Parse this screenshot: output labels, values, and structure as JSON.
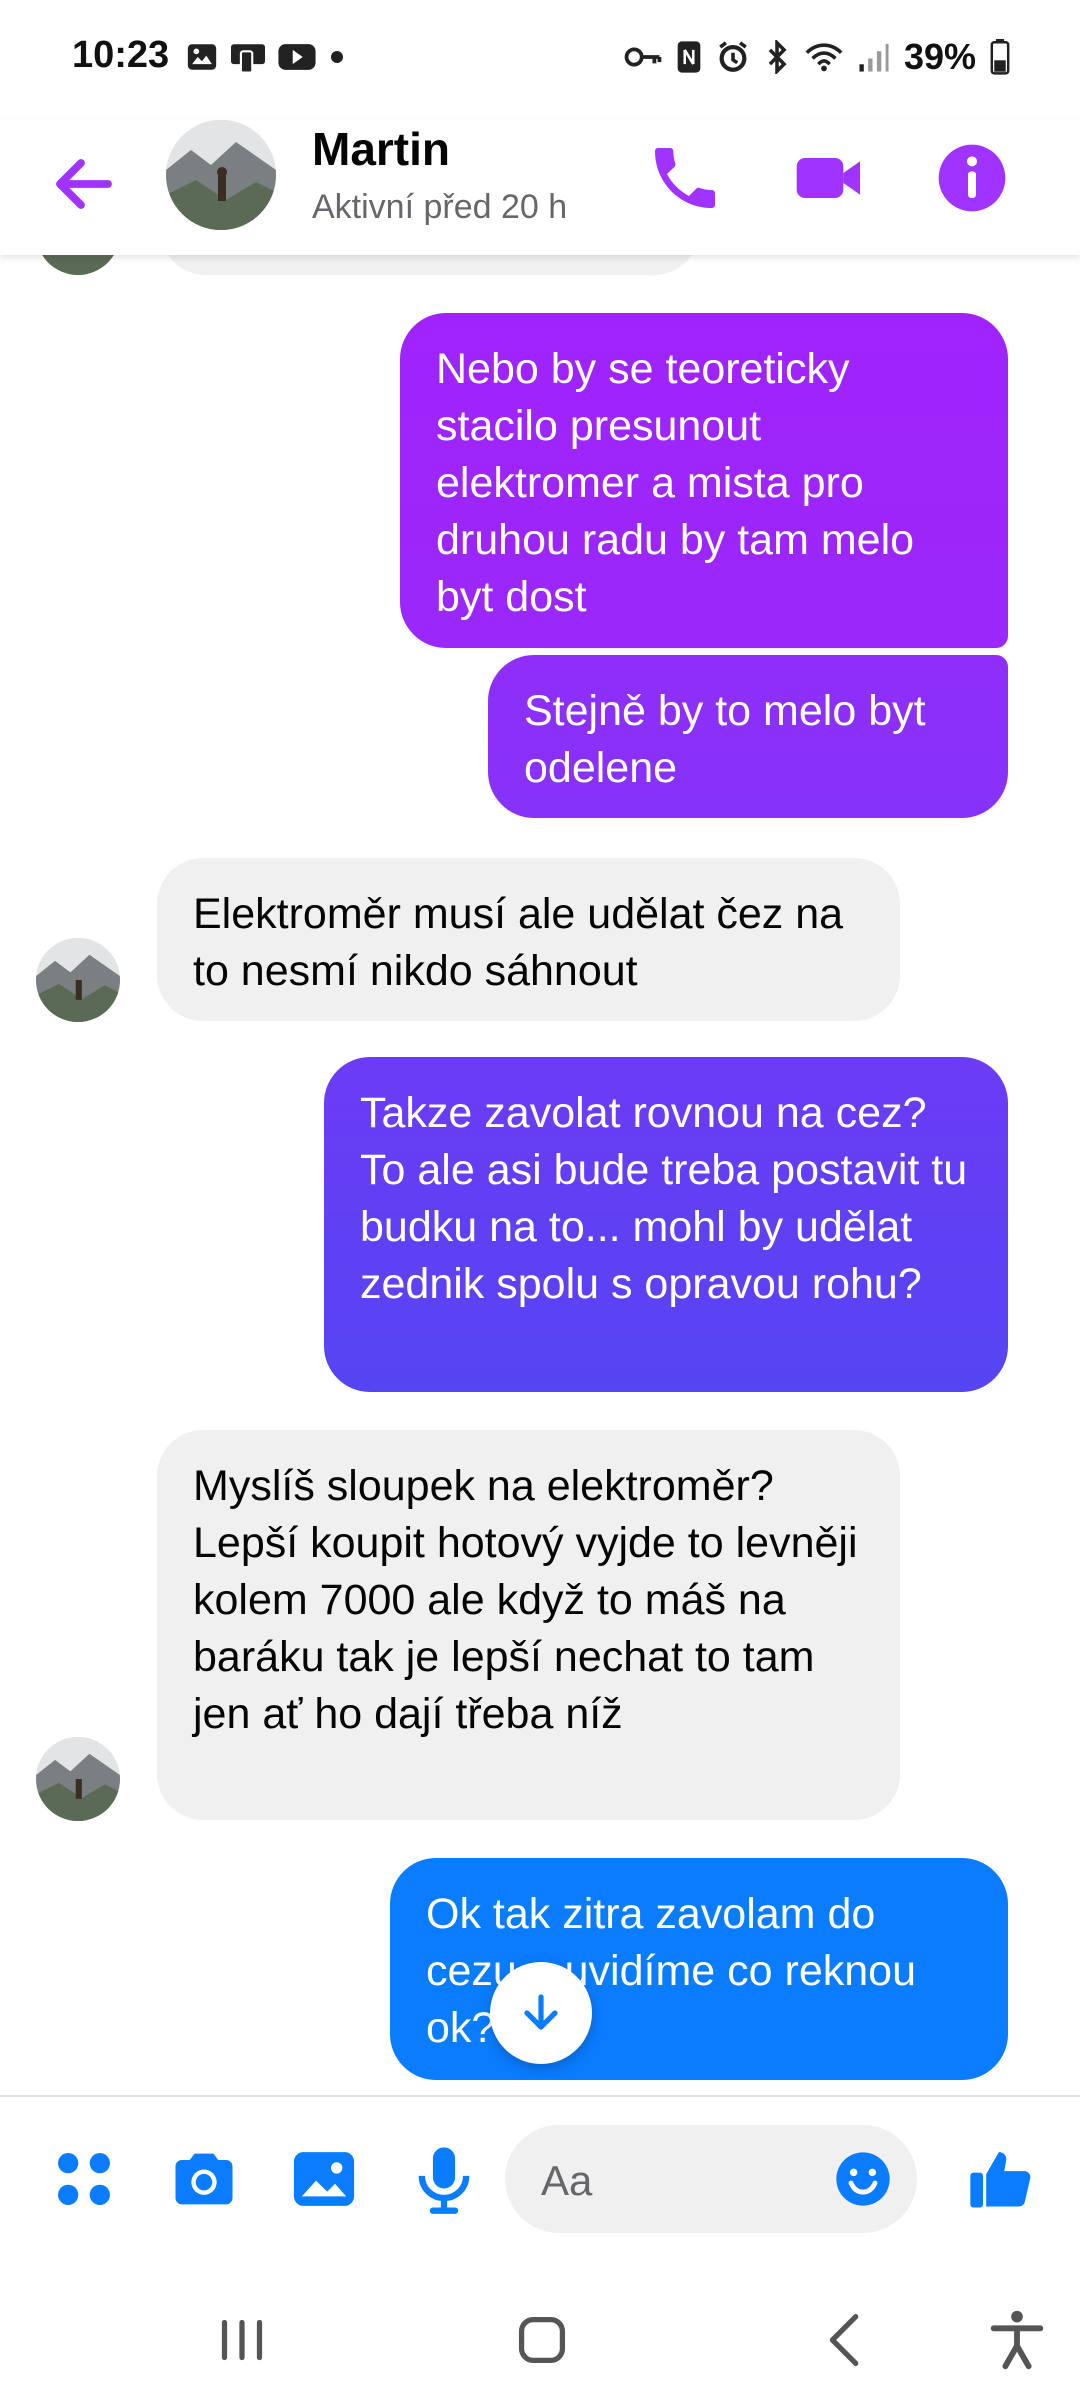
{
  "status_bar": {
    "time": "10:23",
    "battery": "39%"
  },
  "header": {
    "contact_name": "Martin",
    "contact_status": "Aktivní před 20 h",
    "icons": [
      "back-arrow-icon",
      "phone-icon",
      "video-camera-icon",
      "info-icon"
    ]
  },
  "messages": [
    {
      "direction": "outgoing",
      "text": "Nebo by se teoreticky stacilo presunout elektromer a mista pro druhou radu by tam melo byt dost"
    },
    {
      "direction": "outgoing",
      "text": "Stejně by to melo byt odelene"
    },
    {
      "direction": "incoming",
      "text": "Elektroměr musí ale udělat čez na to nesmí nikdo sáhnout"
    },
    {
      "direction": "outgoing",
      "text": "Takze zavolat rovnou na cez? To ale asi bude treba postavit tu budku na to... mohl by udělat zednik spolu s opravou rohu?"
    },
    {
      "direction": "incoming",
      "text": "Myslíš sloupek na elektroměr? Lepší koupit hotový vyjde to levněji kolem 7000 ale když to máš na baráku tak je lepší nechat to tam jen ať ho dají třeba níž"
    },
    {
      "direction": "outgoing",
      "text": "Ok tak zitra zavolam do cezu a uvidíme co reknou ok?"
    }
  ],
  "composer": {
    "placeholder": "Aa",
    "icons": [
      "apps-grid-icon",
      "camera-icon",
      "gallery-icon",
      "microphone-icon",
      "emoji-icon",
      "thumbs-up-icon"
    ]
  },
  "colors": {
    "accent": "#a033ff",
    "blue": "#0a7cff",
    "incoming_bubble": "#f0f0f0"
  }
}
